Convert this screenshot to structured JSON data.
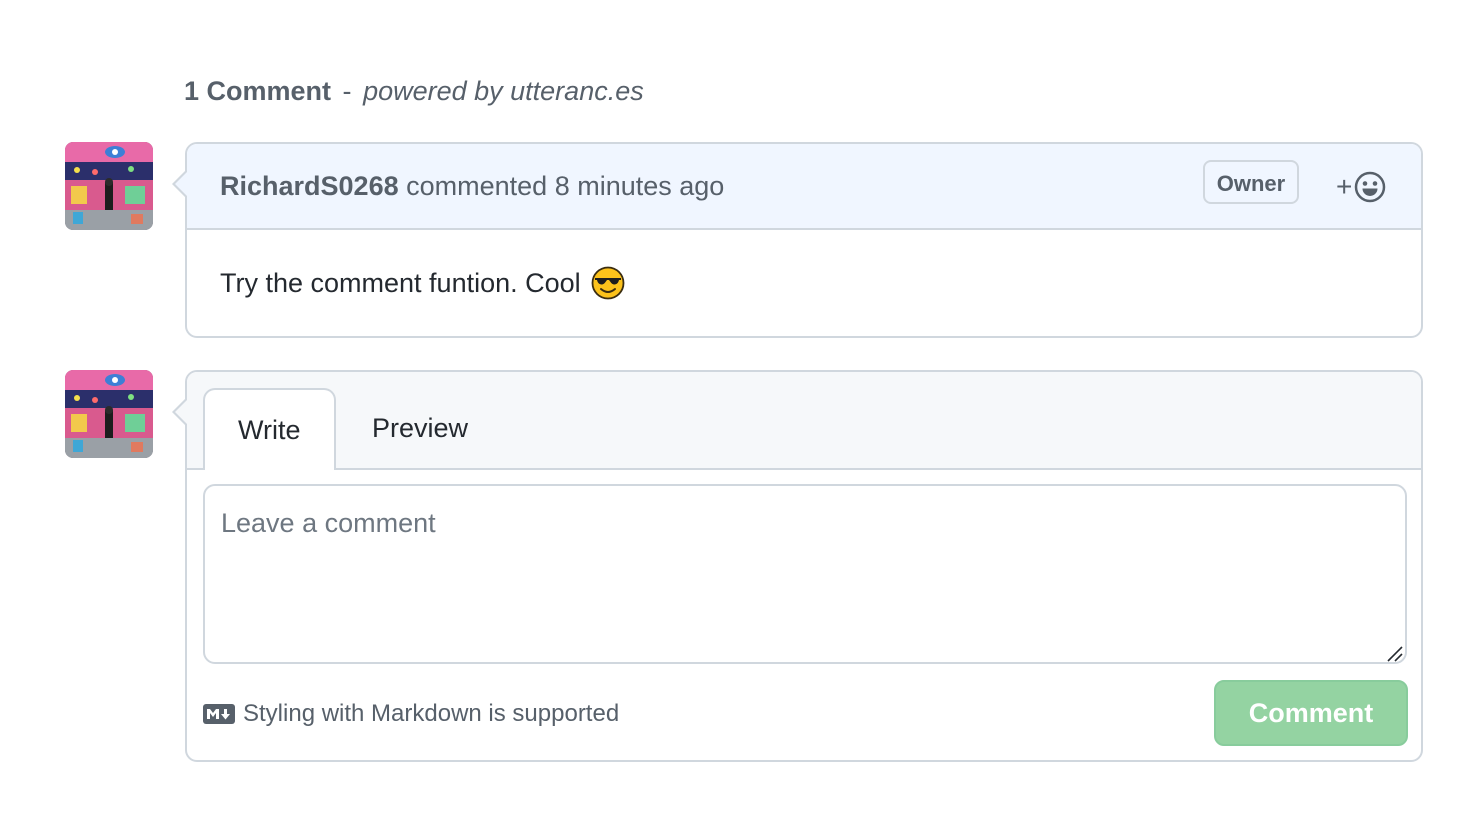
{
  "timeline": {
    "count_label": "1 Comment",
    "separator": "-",
    "powered_by": "powered by utteranc.es"
  },
  "comments": [
    {
      "author": "RichardS0268",
      "action": "commented",
      "time": "8 minutes ago",
      "role_badge": "Owner",
      "reaction_button": "+",
      "body": "Try the comment funtion. Cool",
      "body_emoji": "smiling-face-with-sunglasses"
    }
  ],
  "editor": {
    "tabs": [
      "Write",
      "Preview"
    ],
    "active_tab": "Write",
    "textarea_placeholder": "Leave a comment",
    "textarea_value": "",
    "markdown_hint": "Styling with Markdown is supported",
    "submit_label": "Comment"
  },
  "icons": {
    "markdown": "markdown-icon",
    "reaction": "smiley-icon",
    "resize": "resize-handle-icon"
  },
  "colors": {
    "header_bg": "#f0f6ff",
    "editor_header_bg": "#f6f8fa",
    "border": "#d0d7de",
    "muted_text": "#57606a",
    "submit_bg": "#94d3a2"
  }
}
